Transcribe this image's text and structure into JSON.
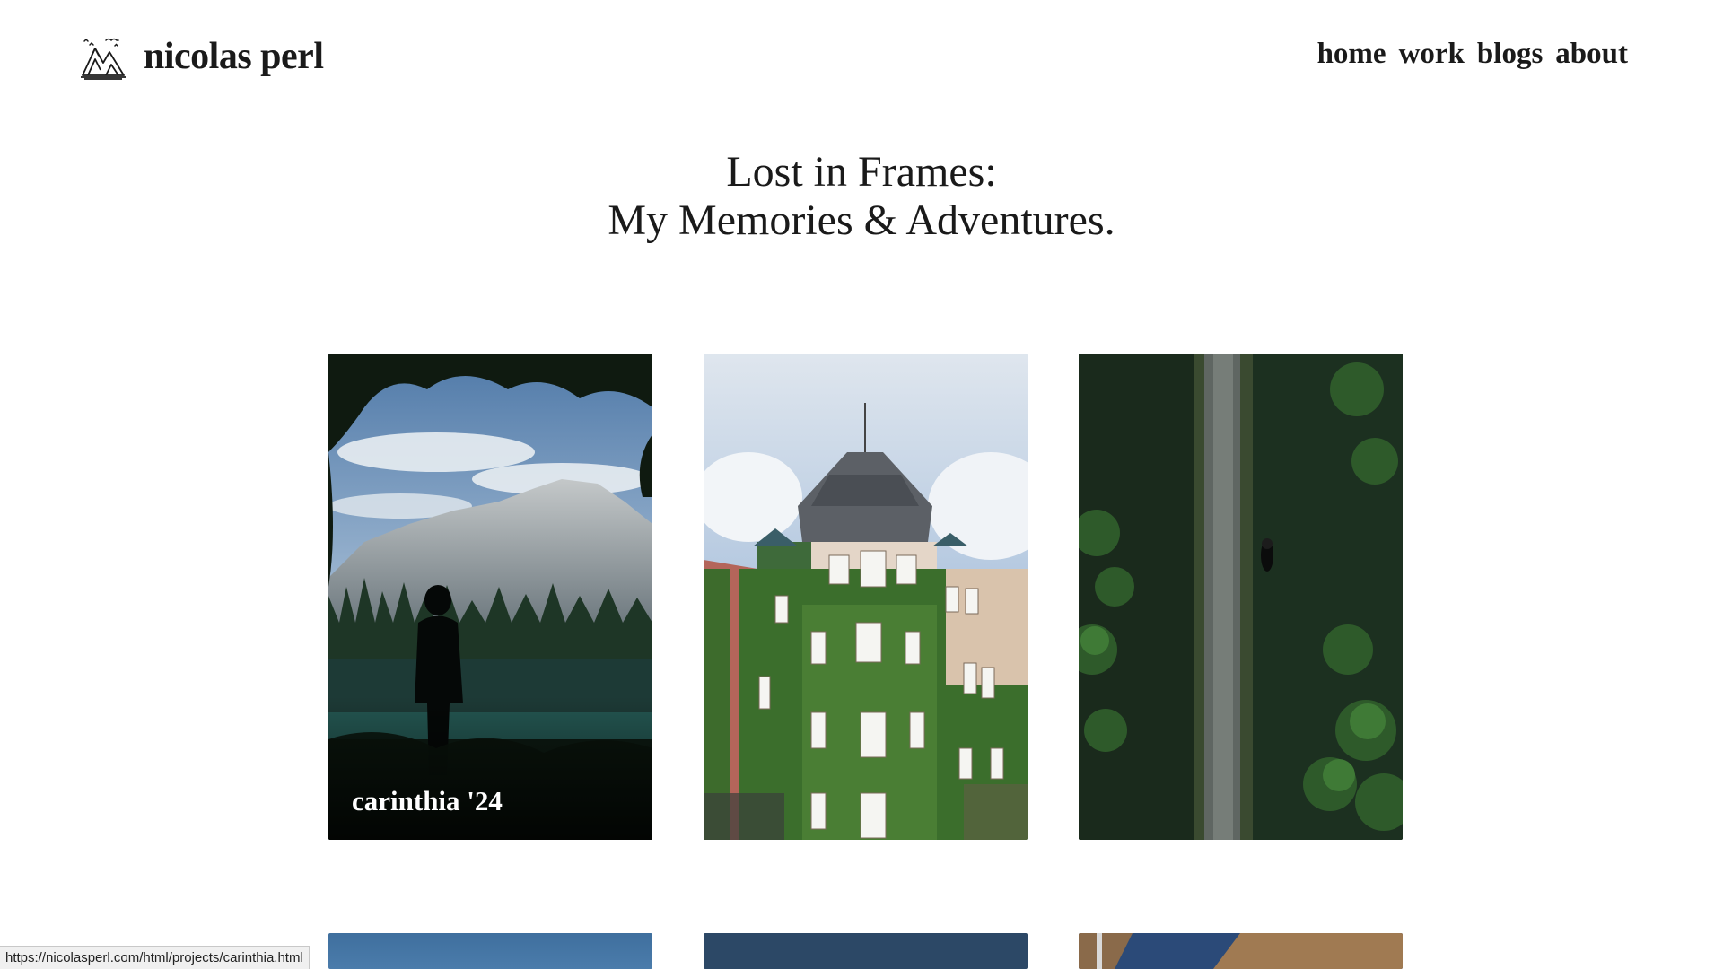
{
  "site": {
    "brand_name": "nicolas perl",
    "logo_icon": "mountains-logo-icon"
  },
  "nav": {
    "items": [
      {
        "label": "home"
      },
      {
        "label": "work"
      },
      {
        "label": "blogs"
      },
      {
        "label": "about"
      }
    ]
  },
  "hero": {
    "line1": "Lost in Frames:",
    "line2": "My Memories & Adventures."
  },
  "gallery": {
    "cards": [
      {
        "caption": "carinthia '24",
        "subject": "mountain lake silhouette"
      },
      {
        "caption": "",
        "subject": "ivy covered building"
      },
      {
        "caption": "",
        "subject": "aerial forest road"
      },
      {
        "caption": "",
        "subject": "blue sky"
      },
      {
        "caption": "",
        "subject": "dark blue sky"
      },
      {
        "caption": "",
        "subject": "boat deck"
      }
    ]
  },
  "status_bar": {
    "url": "https://nicolasperl.com/html/projects/carinthia.html"
  }
}
